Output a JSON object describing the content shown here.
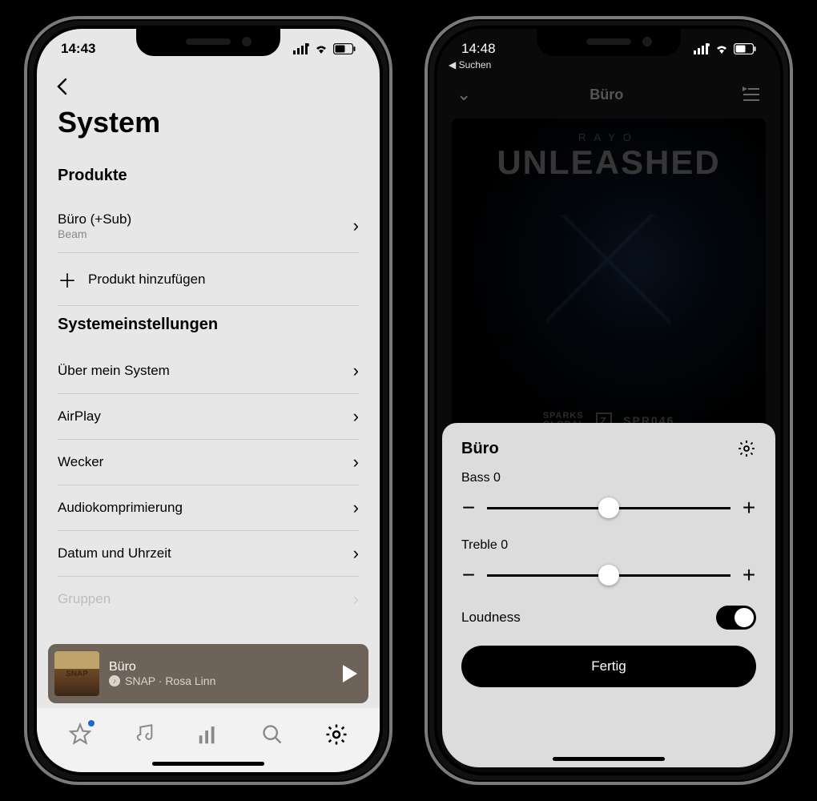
{
  "left": {
    "status": {
      "time": "14:43"
    },
    "page_title": "System",
    "section_products": "Produkte",
    "product": {
      "name": "Büro (+Sub)",
      "sub": "Beam"
    },
    "add_product": "Produkt hinzufügen",
    "section_settings": "Systemeinstellungen",
    "settings": {
      "about": "Über mein System",
      "airplay": "AirPlay",
      "alarm": "Wecker",
      "compression": "Audiokomprimierung",
      "datetime": "Datum und Uhrzeit",
      "groups": "Gruppen"
    },
    "miniplayer": {
      "room": "Büro",
      "track": "SNAP · Rosa Linn",
      "art_text": "SNAP"
    }
  },
  "right": {
    "status": {
      "time": "14:48",
      "back": "Suchen"
    },
    "np": {
      "room": "Büro"
    },
    "album": {
      "artist": "RAYO",
      "title": "UNLEASHED",
      "label1": "SPARKS",
      "label2": "GLOBAL",
      "cat": "SPR046"
    },
    "sheet": {
      "room": "Büro",
      "bass_label": "Bass 0",
      "treble_label": "Treble 0",
      "loudness": "Loudness",
      "done": "Fertig",
      "bass": 0,
      "treble": 0,
      "loudness_on": true
    }
  }
}
